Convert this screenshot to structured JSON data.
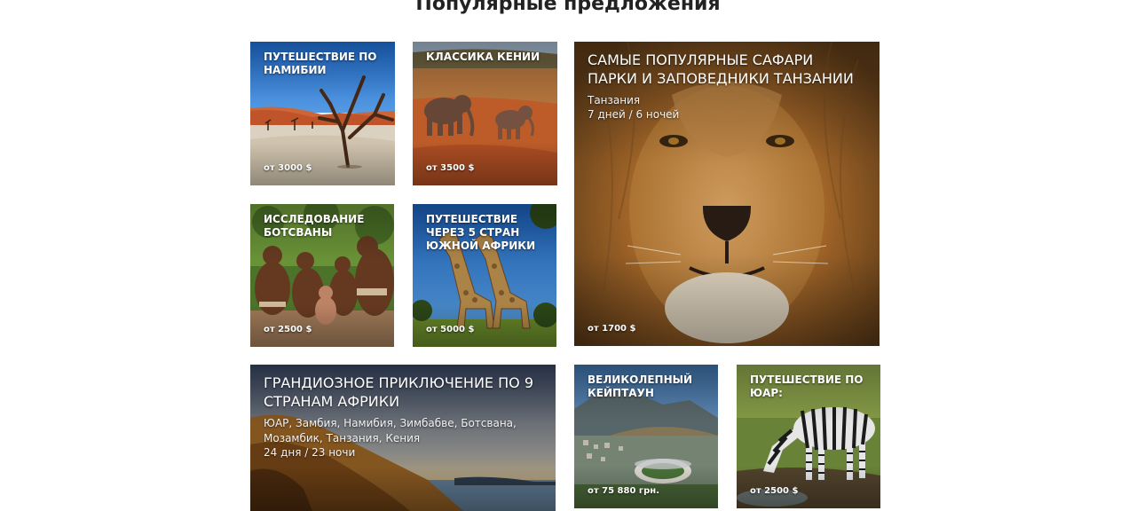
{
  "section": {
    "title": "Популярные предложения"
  },
  "tours": [
    {
      "title": "Путешествие по Намибии",
      "price": "от 3000 $",
      "image": "namibia-dead-trees"
    },
    {
      "title": "Классика Кении",
      "price": "от 3500 $",
      "image": "kenya-elephants"
    },
    {
      "title": "Самые популярные сафари парки и заповедники Танзании",
      "country": "Танзания",
      "duration": "7 дней / 6 ночей",
      "price": "от 1700 $",
      "image": "tanzania-lion"
    },
    {
      "title": "Исследование Ботсваны",
      "price": "от 2500 $",
      "image": "botswana-people"
    },
    {
      "title": "Путешествие через 5 стран Южной Африки",
      "price": "от 5000 $",
      "image": "giraffes"
    },
    {
      "title": "Грандиозное приключение по 9 странам Африки",
      "country": "ЮАР, Замбия, Намибия, Зимбабве, Ботсвана, Мозамбик, Танзания, Кения",
      "duration": "24 дня / 23 ночи",
      "image": "coast-cliffs"
    },
    {
      "title": "Великолепный Кейптаун",
      "price": "от 75 880 грн.",
      "image": "cape-town"
    },
    {
      "title": "Путешествие по ЮАР:",
      "price": "от 2500 $",
      "image": "zebra"
    }
  ]
}
